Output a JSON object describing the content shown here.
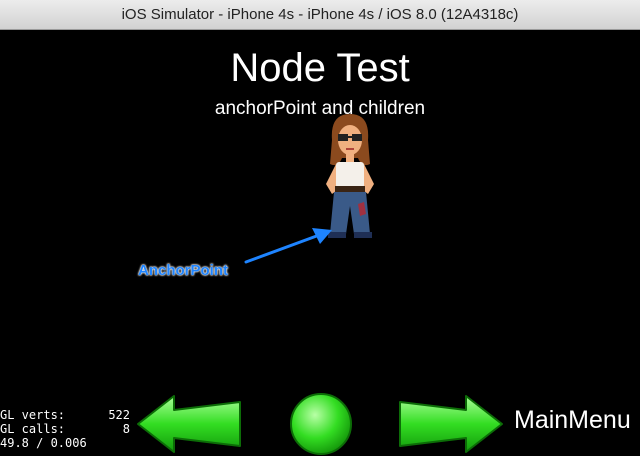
{
  "window": {
    "title": "iOS Simulator - iPhone 4s - iPhone 4s / iOS 8.0 (12A4318c)"
  },
  "scene": {
    "title": "Node Test",
    "subtitle": "anchorPoint and children",
    "anchor_label": "AnchorPoint",
    "anchor_color": "#1e84ff"
  },
  "stats": {
    "verts_label": "GL verts:",
    "verts_value": "522",
    "calls_label": "GL calls:",
    "calls_value": "8",
    "fps": "49.8 / 0.006"
  },
  "menu": {
    "main_menu_label": "MainMenu"
  },
  "colors": {
    "button_green": "#33dd22",
    "background": "#000000"
  }
}
